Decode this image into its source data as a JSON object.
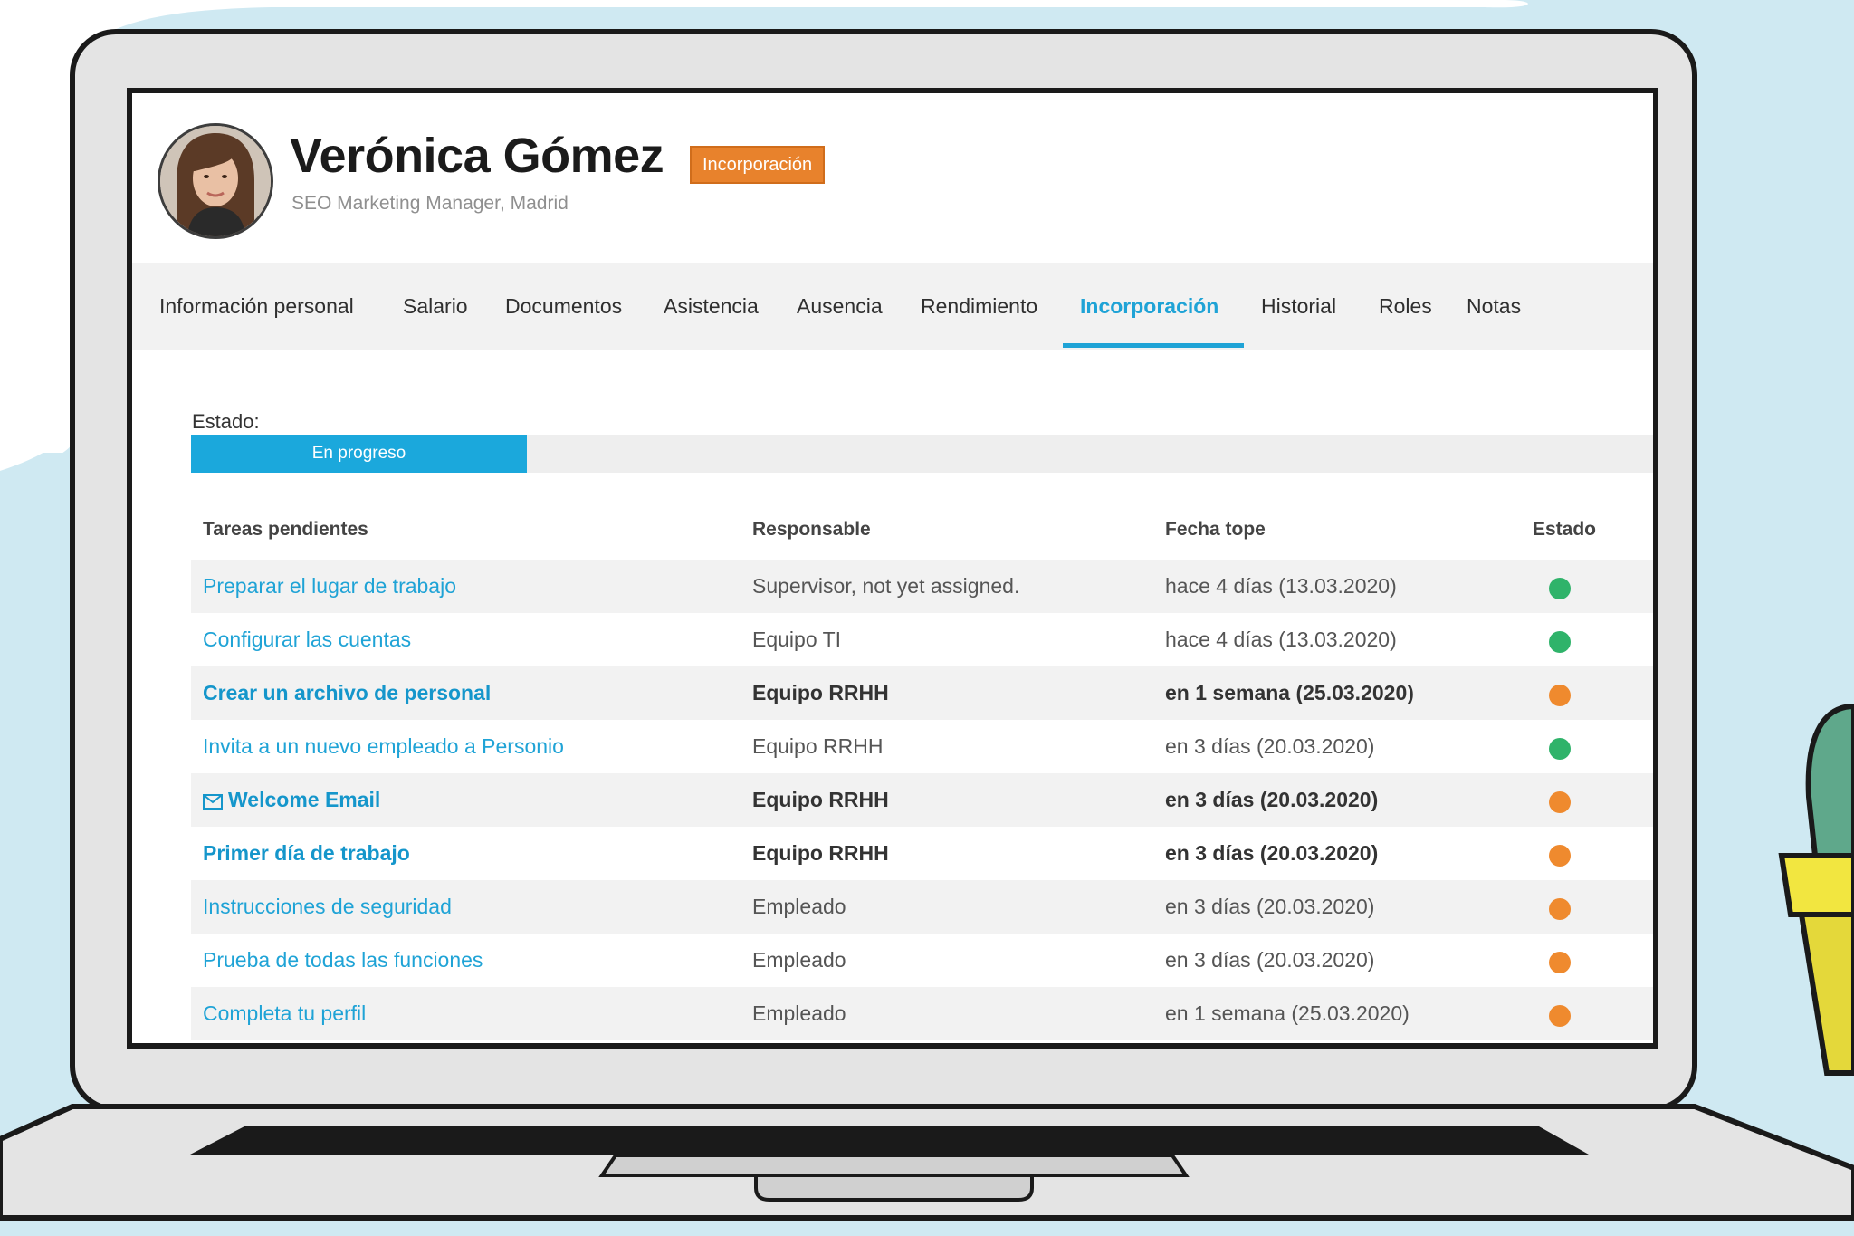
{
  "profile": {
    "name": "Verónica Gómez",
    "badge": "Incorporación",
    "job": "SEO Marketing Manager, Madrid"
  },
  "tabs": [
    {
      "label": "Información personal",
      "active": false
    },
    {
      "label": "Salario",
      "active": false
    },
    {
      "label": "Documentos",
      "active": false
    },
    {
      "label": "Asistencia",
      "active": false
    },
    {
      "label": "Ausencia",
      "active": false
    },
    {
      "label": "Rendimiento",
      "active": false
    },
    {
      "label": "Incorporación",
      "active": true
    },
    {
      "label": "Historial",
      "active": false
    },
    {
      "label": "Roles",
      "active": false
    },
    {
      "label": "Notas",
      "active": false
    }
  ],
  "status": {
    "label": "Estado:",
    "value": "En progreso",
    "progress_fraction": 0.23
  },
  "table": {
    "headers": {
      "task": "Tareas pendientes",
      "owner": "Responsable",
      "due": "Fecha tope",
      "state": "Estado"
    },
    "rows": [
      {
        "task": "Preparar el lugar de trabajo",
        "owner": "Supervisor, not yet assigned.",
        "due": "hace 4 días (13.03.2020)",
        "state": "green",
        "bold": false,
        "icon": null
      },
      {
        "task": "Configurar las cuentas",
        "owner": "Equipo TI",
        "due": "hace 4 días (13.03.2020)",
        "state": "green",
        "bold": false,
        "icon": null
      },
      {
        "task": "Crear un archivo de personal",
        "owner": "Equipo RRHH",
        "due": "en 1 semana (25.03.2020)",
        "state": "orange",
        "bold": true,
        "icon": null
      },
      {
        "task": "Invita a un nuevo empleado a Personio",
        "owner": "Equipo RRHH",
        "due": "en 3 días (20.03.2020)",
        "state": "green",
        "bold": false,
        "icon": null
      },
      {
        "task": "Welcome Email",
        "owner": "Equipo RRHH",
        "due": "en 3 días (20.03.2020)",
        "state": "orange",
        "bold": true,
        "icon": "envelope-icon"
      },
      {
        "task": "Primer día de trabajo",
        "owner": "Equipo RRHH",
        "due": "en 3 días (20.03.2020)",
        "state": "orange",
        "bold": true,
        "icon": null
      },
      {
        "task": "Instrucciones de seguridad",
        "owner": "Empleado",
        "due": "en 3 días (20.03.2020)",
        "state": "orange",
        "bold": false,
        "icon": null
      },
      {
        "task": "Prueba de todas las funciones",
        "owner": "Empleado",
        "due": "en 3 días (20.03.2020)",
        "state": "orange",
        "bold": false,
        "icon": null
      },
      {
        "task": "Completa tu perfil",
        "owner": "Empleado",
        "due": "en 1 semana (25.03.2020)",
        "state": "orange",
        "bold": false,
        "icon": null
      }
    ]
  },
  "colors": {
    "accent": "#1fa3d6",
    "badge": "#e8822c",
    "progress": "#1ba8dc",
    "status_green": "#2fb36a",
    "status_orange": "#ef8a2e"
  }
}
